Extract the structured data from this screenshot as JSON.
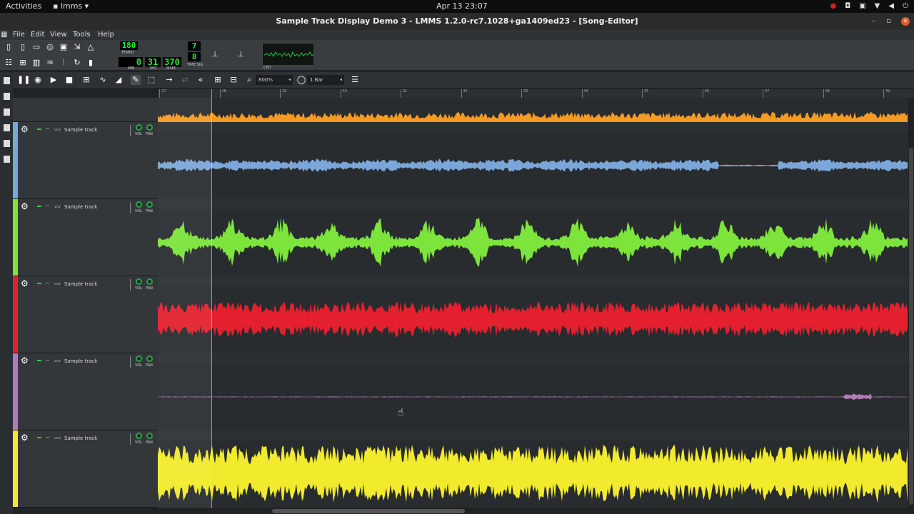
{
  "topbar": {
    "activities": "Activities",
    "app": "lmms",
    "clock": "Apr 13  23:07"
  },
  "window": {
    "title": "Sample Track Display Demo 3 - LMMS 1.2.0-rc7.1028+ga1409ed23 - [Song-Editor]"
  },
  "menu": {
    "file": "File",
    "edit": "Edit",
    "view": "View",
    "tools": "Tools",
    "help": "Help"
  },
  "transport": {
    "tempo": "180",
    "tempo_label": "TEMPO",
    "min": "0",
    "sec": "31",
    "msec": "370",
    "min_label": "MIN",
    "sec_label": "SEC",
    "msec_label": "MSEC",
    "ts_num": "7",
    "ts_den": "8",
    "ts_label": "TIME SIG",
    "cpu_label": "CPU"
  },
  "song_toolbar": {
    "zoom": "800%",
    "quantize": "1 Bar"
  },
  "ruler": {
    "marks": [
      "27",
      "28",
      "29",
      "30",
      "31",
      "32",
      "33",
      "34",
      "35",
      "36",
      "37",
      "38",
      "39"
    ]
  },
  "tracks": [
    {
      "name": "Sample track",
      "vol_label": "VOL",
      "pan_label": "PAN",
      "color": "#7aa6d9"
    },
    {
      "name": "Sample track",
      "vol_label": "VOL",
      "pan_label": "PAN",
      "color": "#7ce43a"
    },
    {
      "name": "Sample track",
      "vol_label": "VOL",
      "pan_label": "PAN",
      "color": "#e4202e"
    },
    {
      "name": "Sample track",
      "vol_label": "VOL",
      "pan_label": "PAN",
      "color": "#b27ab8"
    },
    {
      "name": "Sample track",
      "vol_label": "VOL",
      "pan_label": "PAN",
      "color": "#f2ea2c"
    }
  ],
  "top_wave_color": "#f59a22"
}
